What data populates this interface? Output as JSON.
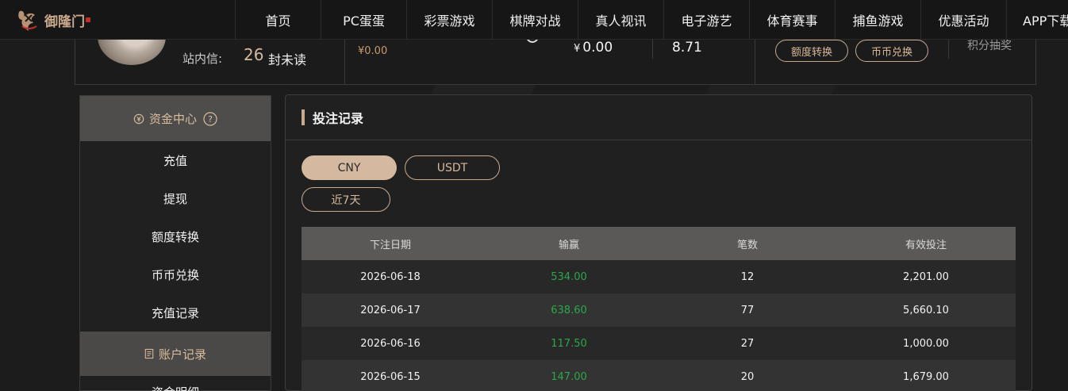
{
  "brand": {
    "name": "御隆门",
    "accent": "#c9a98c"
  },
  "nav": [
    "首页",
    "PC蛋蛋",
    "彩票游戏",
    "棋牌对战",
    "真人视讯",
    "电子游艺",
    "体育赛事",
    "捕鱼游戏",
    "优惠活动",
    "APP下载"
  ],
  "profile": {
    "mail_label": "站内信:",
    "mail_count": "26",
    "mail_unread": "封未读",
    "balance_small": "¥0.00",
    "balance_main_symbol": "¥",
    "balance_main": "0.00",
    "balance_other": "8.71",
    "btn_transfer": "额度转换",
    "btn_exchange": "币币兑换",
    "points_label": "积分抽奖"
  },
  "sidebar": {
    "header": "资金中心",
    "items": [
      "充值",
      "提现",
      "额度转换",
      "币币兑换",
      "充值记录"
    ],
    "header2": "账户记录",
    "partial_item": "资金明细"
  },
  "panel": {
    "title": "投注记录",
    "currency_tabs": [
      "CNY",
      "USDT"
    ],
    "range_label": "近7天"
  },
  "table": {
    "headers": [
      "下注日期",
      "输赢",
      "笔数",
      "有效投注"
    ],
    "rows": [
      {
        "date": "2026-06-18",
        "winloss": "534.00",
        "count": "12",
        "valid": "2,201.00"
      },
      {
        "date": "2026-06-17",
        "winloss": "638.60",
        "count": "77",
        "valid": "5,660.10"
      },
      {
        "date": "2026-06-16",
        "winloss": "117.50",
        "count": "27",
        "valid": "1,000.00"
      },
      {
        "date": "2026-06-15",
        "winloss": "147.00",
        "count": "20",
        "valid": "1,679.00"
      }
    ]
  },
  "colors": {
    "win": "#2aa84a",
    "gold": "#c9a98c"
  }
}
